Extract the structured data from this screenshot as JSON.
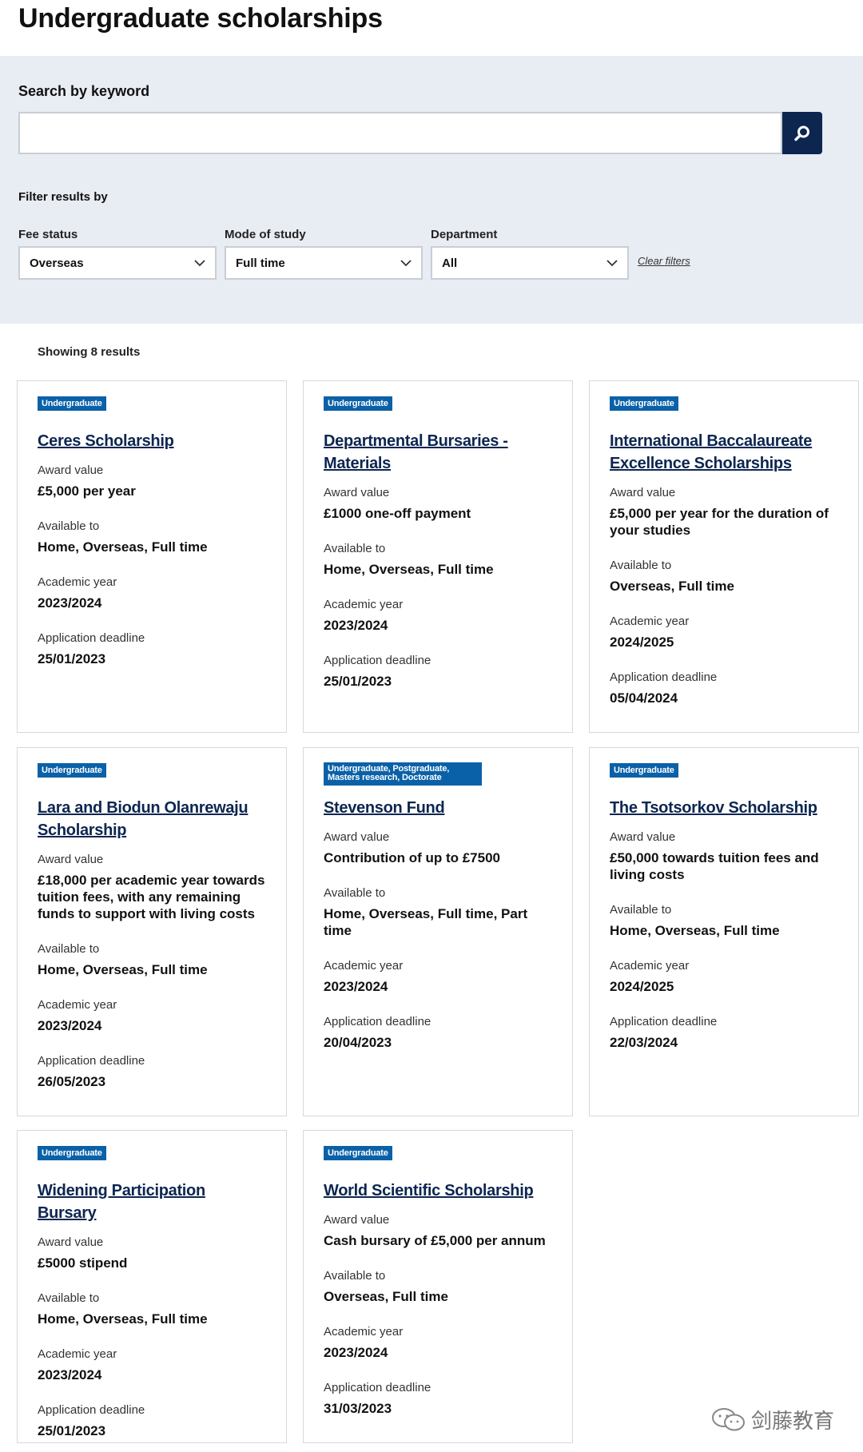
{
  "page": {
    "title": "Undergraduate scholarships"
  },
  "search": {
    "label": "Search by keyword",
    "value": "",
    "placeholder": ""
  },
  "filters": {
    "heading": "Filter results by",
    "fee_status": {
      "label": "Fee status",
      "value": "Overseas"
    },
    "mode_of_study": {
      "label": "Mode of study",
      "value": "Full time"
    },
    "department": {
      "label": "Department",
      "value": "All"
    },
    "clear_label": "Clear filters"
  },
  "results": {
    "count_text": "Showing 8 results",
    "field_labels": {
      "award": "Award value",
      "available": "Available to",
      "year": "Academic year",
      "deadline": "Application deadline"
    },
    "cards": [
      {
        "badge": "Undergraduate",
        "title": "Ceres Scholarship",
        "award": "£5,000 per year",
        "available": "Home, Overseas, Full time",
        "year": "2023/2024",
        "deadline": "25/01/2023"
      },
      {
        "badge": "Undergraduate",
        "title": "Departmental Bursaries - Materials",
        "award": "£1000 one-off payment",
        "available": "Home, Overseas, Full time",
        "year": "2023/2024",
        "deadline": "25/01/2023"
      },
      {
        "badge": "Undergraduate",
        "title": "International Baccalaureate Excellence Scholarships",
        "award": "£5,000 per year for the duration of your studies",
        "available": "Overseas, Full time",
        "year": "2024/2025",
        "deadline": "05/04/2024"
      },
      {
        "badge": "Undergraduate",
        "title": "Lara and Biodun Olanrewaju Scholarship",
        "award": "£18,000 per academic year towards tuition fees, with any remaining funds to support with living costs",
        "available": "Home, Overseas, Full time",
        "year": "2023/2024",
        "deadline": "26/05/2023"
      },
      {
        "badge": "Undergraduate, Postgraduate, Masters research, Doctorate",
        "title": "Stevenson Fund",
        "award": "Contribution of up to £7500",
        "available": "Home, Overseas, Full time, Part time",
        "year": "2023/2024",
        "deadline": "20/04/2023"
      },
      {
        "badge": "Undergraduate",
        "title": "The Tsotsorkov Scholarship",
        "award": "£50,000 towards tuition fees and living costs",
        "available": "Home, Overseas, Full time",
        "year": "2024/2025",
        "deadline": "22/03/2024"
      },
      {
        "badge": "Undergraduate",
        "title": "Widening Participation Bursary",
        "award": "£5000 stipend",
        "available": "Home, Overseas, Full time",
        "year": "2023/2024",
        "deadline": "25/01/2023"
      },
      {
        "badge": "Undergraduate",
        "title": "World Scientific Scholarship",
        "award": "Cash bursary of £5,000 per annum",
        "available": "Overseas, Full time",
        "year": "2023/2024",
        "deadline": "31/03/2023"
      }
    ]
  },
  "watermark": {
    "text": "剑藤教育",
    "icon": "wechat-icon"
  },
  "colors": {
    "panel_bg": "#e8ecf3",
    "navy": "#0c2650",
    "badge_blue": "#0a61a8",
    "card_border": "#d5d8dd"
  }
}
